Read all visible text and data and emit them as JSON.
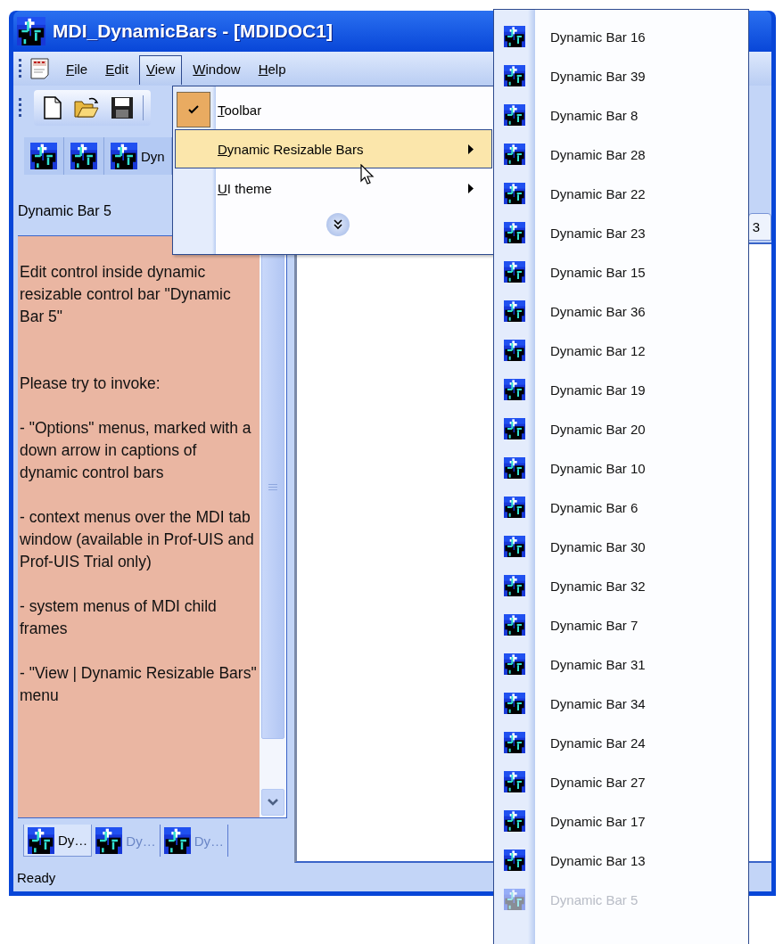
{
  "window": {
    "title": "MDI_DynamicBars - [MDIDOC1]"
  },
  "menu_bar": [
    {
      "label": "File",
      "selected": false
    },
    {
      "label": "Edit",
      "selected": false
    },
    {
      "label": "View",
      "selected": true
    },
    {
      "label": "Window",
      "selected": false
    },
    {
      "label": "Help",
      "selected": false
    }
  ],
  "bars_toolbar": {
    "button_text": "Dyn"
  },
  "left_panel": {
    "caption": "Dynamic Bar 5",
    "paragraphs": [
      "Edit control inside dynamic resizable control bar \"Dynamic Bar 5\"",
      "Please try to invoke:",
      "- \"Options\" menus, marked with a down arrow in captions of dynamic control bars",
      "- context menus over the MDI tab window (available in Prof-UIS and Prof-UIS Trial only)",
      "- system menus of MDI child frames",
      "- \"View | Dynamic Resizable Bars\" menu"
    ],
    "tabs": [
      {
        "label": "Dy…",
        "selected": true
      },
      {
        "label": "Dy…",
        "selected": false
      },
      {
        "label": "Dy…",
        "selected": false
      }
    ]
  },
  "mdi_tab": {
    "label": "3"
  },
  "status_bar": "Ready",
  "view_menu": [
    {
      "label": "Toolbar",
      "kind": "item",
      "checked": true,
      "selected": false
    },
    {
      "label": "Dynamic Resizable Bars",
      "kind": "submenu",
      "checked": false,
      "selected": true
    },
    {
      "label": "UI theme",
      "kind": "submenu",
      "checked": false,
      "selected": false
    }
  ],
  "submenu": [
    {
      "label": "Dynamic Bar 16",
      "disabled": false
    },
    {
      "label": "Dynamic Bar 39",
      "disabled": false
    },
    {
      "label": "Dynamic Bar 8",
      "disabled": false
    },
    {
      "label": "Dynamic Bar 28",
      "disabled": false
    },
    {
      "label": "Dynamic Bar 22",
      "disabled": false
    },
    {
      "label": "Dynamic Bar 23",
      "disabled": false
    },
    {
      "label": "Dynamic Bar 15",
      "disabled": false
    },
    {
      "label": "Dynamic Bar 36",
      "disabled": false
    },
    {
      "label": "Dynamic Bar 12",
      "disabled": false
    },
    {
      "label": "Dynamic Bar 19",
      "disabled": false
    },
    {
      "label": "Dynamic Bar 20",
      "disabled": false
    },
    {
      "label": "Dynamic Bar 10",
      "disabled": false
    },
    {
      "label": "Dynamic Bar 6",
      "disabled": false
    },
    {
      "label": "Dynamic Bar 30",
      "disabled": false
    },
    {
      "label": "Dynamic Bar 32",
      "disabled": false
    },
    {
      "label": "Dynamic Bar 7",
      "disabled": false
    },
    {
      "label": "Dynamic Bar 31",
      "disabled": false
    },
    {
      "label": "Dynamic Bar 34",
      "disabled": false
    },
    {
      "label": "Dynamic Bar 24",
      "disabled": false
    },
    {
      "label": "Dynamic Bar 27",
      "disabled": false
    },
    {
      "label": "Dynamic Bar 17",
      "disabled": false
    },
    {
      "label": "Dynamic Bar 13",
      "disabled": false
    },
    {
      "label": "Dynamic Bar 5",
      "disabled": true
    }
  ]
}
